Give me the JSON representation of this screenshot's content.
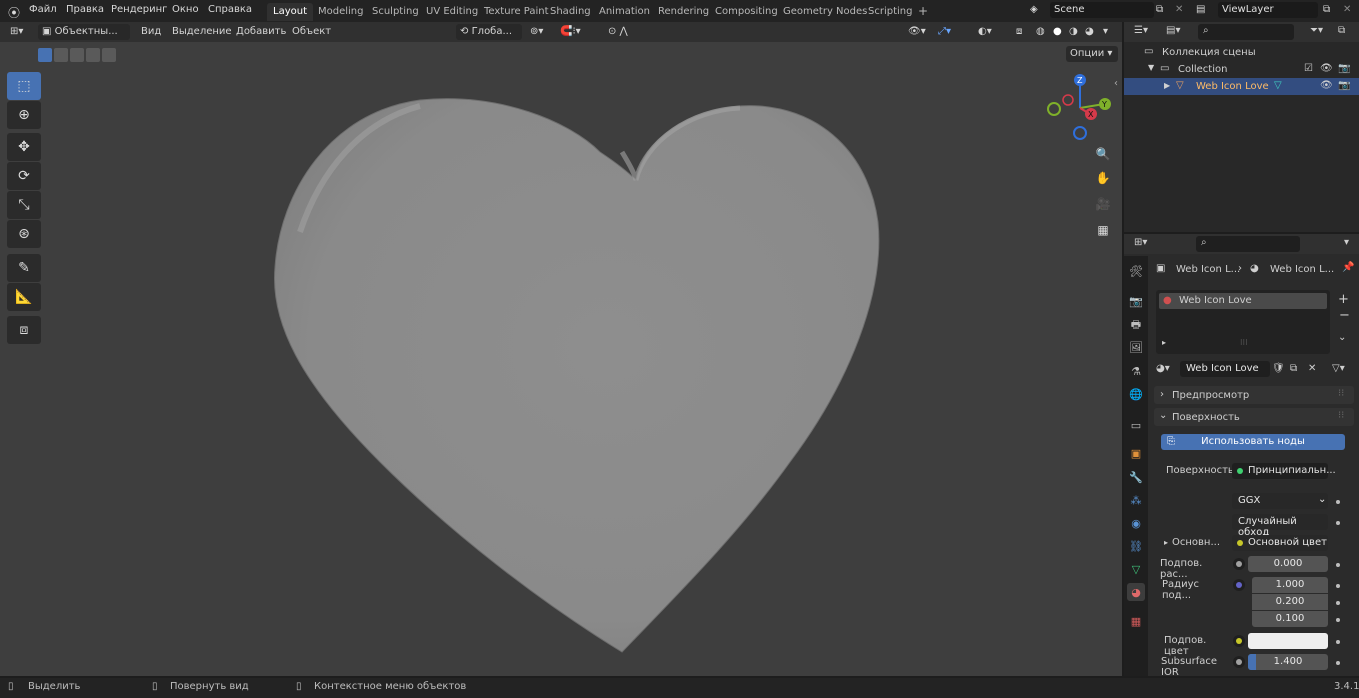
{
  "topbar": {
    "menus": [
      "Файл",
      "Правка",
      "Рендеринг",
      "Окно",
      "Справка"
    ],
    "workspaces": [
      "Layout",
      "Modeling",
      "Sculpting",
      "UV Editing",
      "Texture Paint",
      "Shading",
      "Animation",
      "Rendering",
      "Compositing",
      "Geometry Nodes",
      "Scripting"
    ],
    "active_workspace": "Layout",
    "add_tab": "+",
    "scene": "Scene",
    "view_layer": "ViewLayer"
  },
  "viewport": {
    "mode": "Объектны...",
    "menus": [
      "Вид",
      "Выделение",
      "Добавить",
      "Объект"
    ],
    "orientation": "Глоба...",
    "options": "Опции",
    "gizmo": {
      "x": "X",
      "y": "Y",
      "z": "Z"
    },
    "mesh_color": "#8f8f8f"
  },
  "outliner": {
    "scene_collection": "Коллекция сцены",
    "collection": "Collection",
    "object": "Web Icon Love"
  },
  "properties": {
    "breadcrumb_object": "Web Icon L...",
    "breadcrumb_material": "Web Icon L...",
    "material_slot": "Web Icon Love",
    "material_name": "Web Icon Love",
    "panel_preview": "Предпросмотр",
    "panel_surface": "Поверхность",
    "use_nodes_button": "Использовать ноды",
    "surface_label": "Поверхность",
    "surface_value": "Принципиальн...",
    "distribution": "GGX",
    "subsurface_method": "Случайный обход",
    "base_label": "Основн...",
    "base_value": "Основной цвет",
    "sub_weight_label": "Подпов. рас...",
    "sub_weight_value": "0.000",
    "sub_radius_label": "Радиус под...",
    "sub_radius_values": [
      "1.000",
      "0.200",
      "0.100"
    ],
    "sub_color_label": "Подпов. цвет",
    "sub_ior_label": "Subsurface IOR",
    "sub_ior_value": "1.400",
    "accent": "#4772b3"
  },
  "statusbar": {
    "select": "Выделить",
    "rotate": "Повернуть вид",
    "context": "Контекстное меню объектов",
    "version": "3.4.1"
  }
}
